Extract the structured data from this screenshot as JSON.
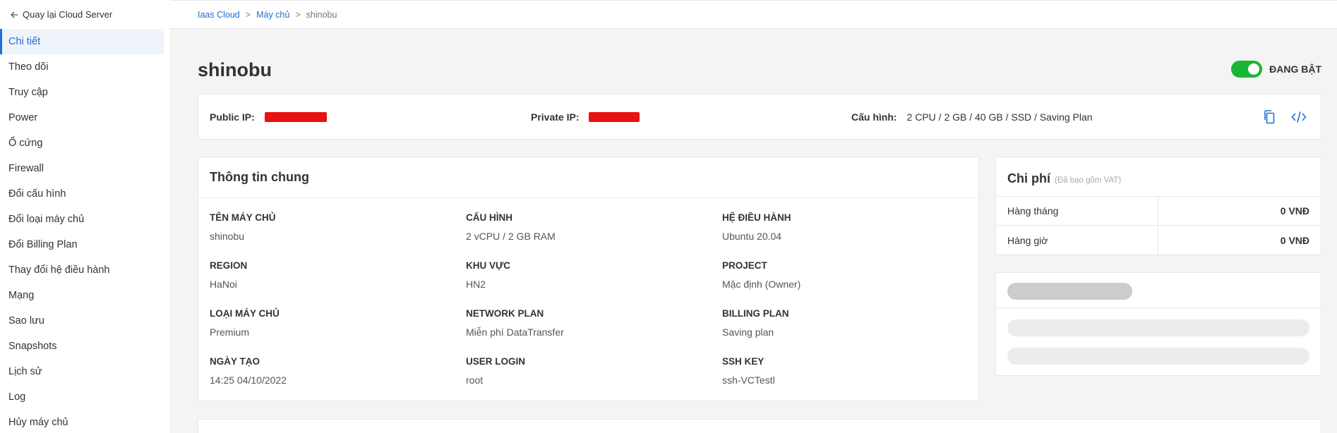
{
  "sidebar": {
    "back_label": "Quay lại Cloud Server",
    "items": [
      {
        "label": "Chi tiết",
        "active": true
      },
      {
        "label": "Theo dõi"
      },
      {
        "label": "Truy cập"
      },
      {
        "label": "Power"
      },
      {
        "label": "Ổ cứng"
      },
      {
        "label": "Firewall"
      },
      {
        "label": "Đổi cấu hình"
      },
      {
        "label": "Đổi loại máy chủ"
      },
      {
        "label": "Đổi Billing Plan"
      },
      {
        "label": "Thay đổi hệ điều hành"
      },
      {
        "label": "Mạng"
      },
      {
        "label": "Sao lưu"
      },
      {
        "label": "Snapshots"
      },
      {
        "label": "Lịch sử"
      },
      {
        "label": "Log"
      },
      {
        "label": "Hủy máy chủ"
      }
    ]
  },
  "breadcrumb": {
    "items": [
      "Iaas Cloud",
      "Máy chủ",
      "shinobu"
    ],
    "separator": ">"
  },
  "header": {
    "title": "shinobu",
    "status_label": "ĐANG BẬT",
    "status_on": true
  },
  "ip_bar": {
    "public_ip_label": "Public IP:",
    "private_ip_label": "Private IP:",
    "config_label": "Cấu hình:",
    "config_value": "2 CPU / 2 GB / 40 GB / SSD / Saving Plan",
    "icons": [
      "copy-icon",
      "code-icon"
    ]
  },
  "info": {
    "title": "Thông tin chung",
    "fields": [
      {
        "key": "TÊN MÁY CHỦ",
        "value": "shinobu"
      },
      {
        "key": "CẤU HÌNH",
        "value": "2 vCPU / 2 GB RAM"
      },
      {
        "key": "HỆ ĐIỀU HÀNH",
        "value": "Ubuntu 20.04"
      },
      {
        "key": "REGION",
        "value": "HaNoi"
      },
      {
        "key": "KHU VỰC",
        "value": "HN2"
      },
      {
        "key": "PROJECT",
        "value": "Mặc định (Owner)"
      },
      {
        "key": "LOẠI MÁY CHỦ",
        "value": "Premium"
      },
      {
        "key": "NETWORK PLAN",
        "value": "Miễn phí DataTransfer"
      },
      {
        "key": "BILLING PLAN",
        "value": "Saving plan"
      },
      {
        "key": "NGÀY TẠO",
        "value": "14:25 04/10/2022"
      },
      {
        "key": "USER LOGIN",
        "value": "root"
      },
      {
        "key": "SSH KEY",
        "value": "ssh-VCTestl"
      }
    ]
  },
  "cost": {
    "title": "Chi phí",
    "subtitle": "(Đã bao gồm VAT)",
    "rows": [
      {
        "label": "Hàng tháng",
        "value": "0 VNĐ"
      },
      {
        "label": "Hàng giờ",
        "value": "0 VNĐ"
      }
    ]
  },
  "colors": {
    "accent": "#1e6fd9",
    "toggle_on": "#1ab533",
    "redaction": "#e8120f",
    "skeleton": "#cccccc"
  }
}
